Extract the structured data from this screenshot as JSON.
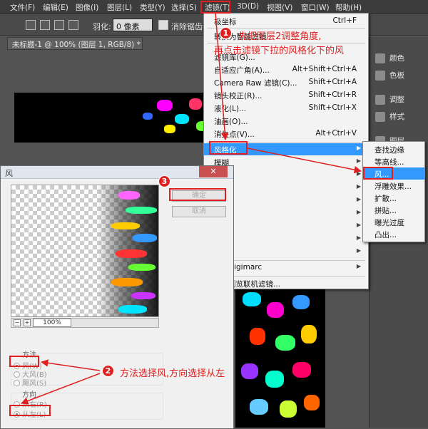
{
  "menubar": {
    "items": [
      "文件(F)",
      "编辑(E)",
      "图像(I)",
      "图层(L)",
      "类型(Y)",
      "选择(S)",
      "滤镜(T)",
      "3D(D)",
      "视图(V)",
      "窗口(W)",
      "帮助(H)"
    ]
  },
  "options": {
    "feather_label": "羽化:",
    "feather_value": "0 像素",
    "antialias_label": "消除锯齿"
  },
  "document": {
    "tab_title": "未标题-1 @ 100% (图层 1, RGB/8) *"
  },
  "filter_menu": {
    "items": [
      {
        "label": "极坐标",
        "shortcut": "Ctrl+F"
      },
      {
        "label": "转换为智能滤镜",
        "shortcut": ""
      },
      {
        "label": "滤镜库(G)...",
        "shortcut": ""
      },
      {
        "label": "自适应广角(A)...",
        "shortcut": "Alt+Shift+Ctrl+A"
      },
      {
        "label": "Camera Raw 滤镜(C)...",
        "shortcut": "Shift+Ctrl+A"
      },
      {
        "label": "镜头校正(R)...",
        "shortcut": "Shift+Ctrl+R"
      },
      {
        "label": "液化(L)...",
        "shortcut": "Shift+Ctrl+X"
      },
      {
        "label": "油画(O)...",
        "shortcut": ""
      },
      {
        "label": "消失点(V)...",
        "shortcut": "Alt+Ctrl+V"
      },
      {
        "label": "风格化",
        "shortcut": ""
      },
      {
        "label": "模糊",
        "shortcut": ""
      },
      {
        "label": "Digimarc",
        "shortcut": ""
      },
      {
        "label": "浏览联机滤镜...",
        "shortcut": ""
      }
    ],
    "active": "风格化",
    "digimarc_partial": "Digimarc"
  },
  "submenu": {
    "items": [
      "查找边缘",
      "等高线...",
      "风...",
      "浮雕效果...",
      "扩散...",
      "拼贴...",
      "曝光过度",
      "凸出..."
    ]
  },
  "panels": {
    "items": [
      "颜色",
      "色板",
      "调整",
      "样式",
      "图层"
    ]
  },
  "dialog": {
    "title": "风",
    "ok": "确定",
    "cancel": "取消",
    "zoom": "100%",
    "zoom_minus": "−",
    "zoom_plus": "+",
    "method_label": "方法",
    "method_options": [
      "风(W)",
      "大风(B)",
      "飓风(S)"
    ],
    "direction_label": "方向",
    "direction_options": [
      "从右(R)",
      "从左(L)"
    ]
  },
  "annotations": {
    "step1_num": "1",
    "step1_line1": "先把图层2调整角度,",
    "step1_line2": "再点击滤镜下拉的风格化下的风",
    "step2_num": "2",
    "step2_text": "方法选择风,方向选择从左",
    "step3_num": "3",
    "color": "#e02020"
  }
}
